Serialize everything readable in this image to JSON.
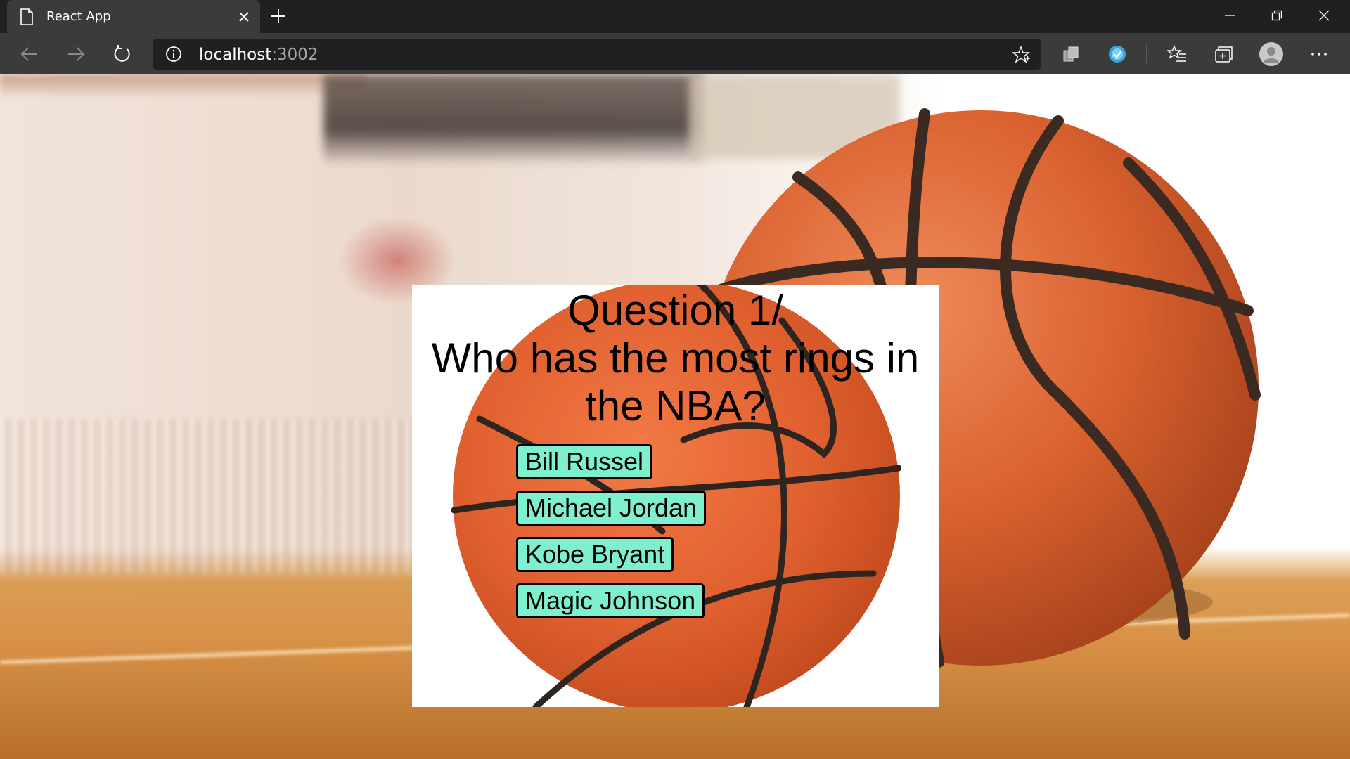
{
  "browser": {
    "tab_title": "React App",
    "url_host": "localhost",
    "url_port": ":3002"
  },
  "quiz": {
    "question_number": "Question 1/",
    "question_text": "Who has the most rings in the NBA?",
    "answers": [
      "Bill Russel",
      "Michael Jordan",
      "Kobe Bryant",
      "Magic Johnson"
    ]
  },
  "colors": {
    "answer_button": "#7ff0ce",
    "chrome_dark": "#202020",
    "chrome_toolbar": "#3b3b3b",
    "ball_orange": "#e0602f"
  },
  "icons": [
    "page-icon",
    "close-icon",
    "plus-icon",
    "minimize-icon",
    "restore-icon",
    "back-arrow-icon",
    "forward-arrow-icon",
    "refresh-icon",
    "info-icon",
    "star-icon",
    "extension-icon",
    "favorites-icon",
    "collections-icon",
    "profile-icon",
    "more-icon"
  ]
}
